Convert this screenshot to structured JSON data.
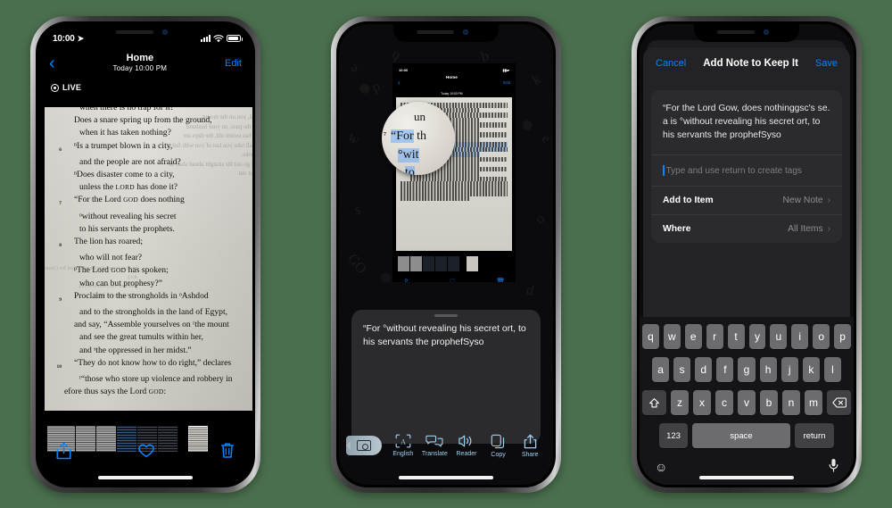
{
  "background_color": "#4a6f4e",
  "phone1": {
    "name": "photos-live-text-view",
    "status": {
      "time": "10:00",
      "location_icon": "location-arrow-icon",
      "signal": "cellular-bars-icon",
      "wifi": "wifi-icon",
      "battery": "battery-icon"
    },
    "nav": {
      "back": "‹",
      "title": "Home",
      "subtitle": "Today  10:00 PM",
      "edit": "Edit"
    },
    "live_badge": "LIVE",
    "page_text": {
      "ghost_lines": [
        "ord, you on the mount",
        "as the pass, on your husband",
        "or has sworn old, the days are",
        "shall take you last of you with fish hooks.",
        "all go out thr straight ahead shall be cast out"
      ],
      "ghost_lines2": [
        "he was a wa sd to be rom God for (Amos 4:1).",
        "plucked out (Amos 4:11).",
        "ce in a gracel land"
      ],
      "verses": [
        {
          "num": "",
          "indent": "ind1",
          "text": "when there is no trap for it?"
        },
        {
          "num": "",
          "indent": "ind3",
          "text": "Does a snare spring up from the ground,"
        },
        {
          "num": "",
          "indent": "ind1",
          "text": "when it has taken nothing?"
        },
        {
          "num": "6",
          "indent": "ind3",
          "text": "ⁿIs a trumpet blown in a city,"
        },
        {
          "num": "",
          "indent": "ind1",
          "text": "and the people are not afraid?"
        },
        {
          "num": "",
          "indent": "ind3",
          "text": "ⁿDoes disaster come to a city,"
        },
        {
          "num": "",
          "indent": "ind1",
          "text": "unless the LORD has done it?"
        },
        {
          "num": "7",
          "indent": "ind3",
          "text": "“For the Lord GOD does nothing"
        },
        {
          "num": "",
          "indent": "ind1",
          "text": "ᵒwithout revealing his secret"
        },
        {
          "num": "",
          "indent": "ind1",
          "text": "to his servants the prophets."
        },
        {
          "num": "8",
          "indent": "ind3",
          "text": "The lion has roared;"
        },
        {
          "num": "",
          "indent": "ind1",
          "text": "who will not fear?"
        },
        {
          "num": "",
          "indent": "ind3",
          "text": "ᵖThe Lord GOD has spoken;"
        },
        {
          "num": "",
          "indent": "ind1",
          "text": "who can but prophesy?”"
        },
        {
          "num": "9",
          "indent": "ind3",
          "text": "Proclaim to the strongholds in ᵒAshdod"
        },
        {
          "num": "",
          "indent": "ind1",
          "text": "and to the strongholds in the land of Egypt,"
        },
        {
          "num": "",
          "indent": "ind3",
          "text": "and say, “Assemble yourselves on ʳthe mount"
        },
        {
          "num": "",
          "indent": "ind1",
          "text": "and see the great tumults within her,"
        },
        {
          "num": "",
          "indent": "ind1",
          "text": "and ˢthe oppressed in her midst.”"
        },
        {
          "num": "10",
          "indent": "ind3",
          "text": "“They do not know how to do right,” declares"
        },
        {
          "num": "",
          "indent": "ind1",
          "text": "ᵗ“those who store up violence and robbery in"
        },
        {
          "num": "",
          "indent": "",
          "text": "efore thus says the Lord GOD:"
        }
      ]
    },
    "toolbar": {
      "share": "share-icon",
      "favorite": "heart-icon",
      "delete": "trash-icon"
    }
  },
  "phone2": {
    "name": "live-text-selection-view",
    "mini": {
      "time": "10:00",
      "title": "Home",
      "subtitle": "Today  10:00 PM",
      "back": "‹",
      "edit": "Edit"
    },
    "loupe": {
      "top_fragment": "un",
      "line1_plain": "th",
      "line1_sel": "“For",
      "line2_sel": "°wit",
      "line3_sel": "to",
      "verse_num": "7"
    },
    "quote": "“For °without revealing his secret ort, to his servants the prophefSyso",
    "toolbar": {
      "camera": "live-text-camera-icon",
      "items": [
        {
          "icon": "translate-language-icon",
          "label": "English"
        },
        {
          "icon": "translate-icon",
          "label": "Translate"
        },
        {
          "icon": "speaker-reader-icon",
          "label": "Reader"
        },
        {
          "icon": "copy-icon",
          "label": "Copy"
        },
        {
          "icon": "share-icon",
          "label": "Share"
        }
      ]
    }
  },
  "phone3": {
    "name": "add-note-to-keep-it-sheet",
    "nav": {
      "cancel": "Cancel",
      "title": "Add Note to Keep It",
      "save": "Save"
    },
    "note_text": "“For the Lord Gow, does nothinggsc's se. a is °without revealing his secret ort, to his servants the prophefSyso",
    "tag_placeholder": "Type and use return to create tags",
    "rows": [
      {
        "label": "Add to Item",
        "value": "New Note",
        "chevron": "chevron-right-icon"
      },
      {
        "label": "Where",
        "value": "All Items",
        "chevron": "chevron-right-icon"
      }
    ],
    "keyboard": {
      "row1": [
        "q",
        "w",
        "e",
        "r",
        "t",
        "y",
        "u",
        "i",
        "o",
        "p"
      ],
      "row2": [
        "a",
        "s",
        "d",
        "f",
        "g",
        "h",
        "j",
        "k",
        "l"
      ],
      "row3": [
        "z",
        "x",
        "c",
        "v",
        "b",
        "n",
        "m"
      ],
      "shift": "shift-icon",
      "backspace": "backspace-icon",
      "numbers": "123",
      "space": "space",
      "return": "return",
      "emoji": "emoji-icon",
      "dictation": "microphone-icon"
    }
  }
}
